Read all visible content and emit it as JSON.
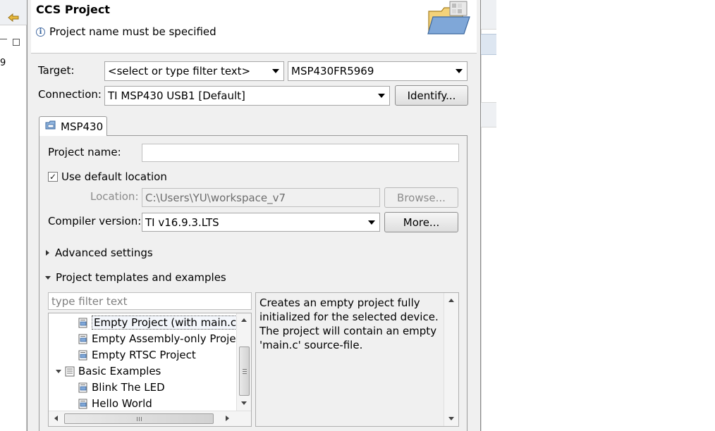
{
  "dialog": {
    "title": "CCS Project",
    "message": "Project name must be specified"
  },
  "target": {
    "label": "Target:",
    "filter_placeholder": "<select or type filter text>",
    "device": "MSP430FR5969"
  },
  "connection": {
    "label": "Connection:",
    "value": "TI MSP430 USB1 [Default]",
    "identify_label": "Identify..."
  },
  "tab": {
    "label": "MSP430"
  },
  "project": {
    "name_label": "Project name:",
    "name_value": "",
    "use_default_label": "Use default location",
    "use_default_checked": true,
    "location_label": "Location:",
    "location_value": "C:\\Users\\YU\\workspace_v7",
    "browse_label": "Browse...",
    "compiler_label": "Compiler version:",
    "compiler_value": "TI v16.9.3.LTS",
    "more_label": "More..."
  },
  "sections": {
    "advanced": "Advanced settings",
    "templates": "Project templates and examples"
  },
  "templates": {
    "filter_placeholder": "type filter text",
    "items": [
      {
        "label": "Empty Project (with main.c)",
        "selected": true
      },
      {
        "label": "Empty Assembly-only Project",
        "selected": false
      },
      {
        "label": "Empty RTSC Project",
        "selected": false
      },
      {
        "label": "Basic Examples",
        "selected": false
      },
      {
        "label": "Blink The LED",
        "selected": false
      },
      {
        "label": "Hello World",
        "selected": false
      }
    ],
    "description": "Creates an empty project fully initialized for the selected device. The project will contain an empty 'main.c' source-file."
  },
  "background": {
    "left_number": "9"
  },
  "colors": {
    "dialog_bg": "#f0f0f0",
    "header_bg": "#ffffff",
    "info_icon": "#2f5f9c",
    "folder_icon": "#e8b84a"
  }
}
